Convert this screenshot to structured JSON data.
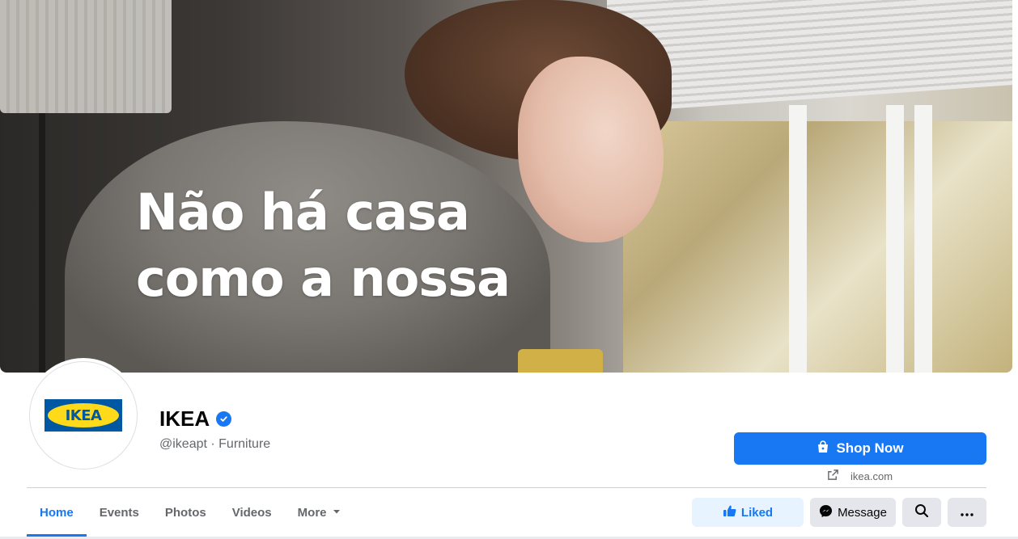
{
  "cover": {
    "headline_line1": "Não há casa",
    "headline_line2": "como a nossa"
  },
  "profile": {
    "logo_text": "IKEA",
    "name": "IKEA",
    "handle_category": "@ikeapt · Furniture"
  },
  "cta": {
    "shop_label": "Shop Now",
    "website": "ikea.com"
  },
  "tabs": [
    {
      "label": "Home",
      "active": true
    },
    {
      "label": "Events"
    },
    {
      "label": "Photos"
    },
    {
      "label": "Videos"
    },
    {
      "label": "More"
    }
  ],
  "actions": {
    "liked_label": "Liked",
    "message_label": "Message"
  },
  "colors": {
    "accent": "#1877f2",
    "ikea_blue": "#0058a3",
    "ikea_yellow": "#ffda1a"
  },
  "icons": [
    "verified-badge-icon",
    "shopping-bag-icon",
    "external-link-icon",
    "chevron-down-icon",
    "thumbs-up-icon",
    "messenger-icon",
    "search-icon",
    "ellipsis-icon"
  ]
}
